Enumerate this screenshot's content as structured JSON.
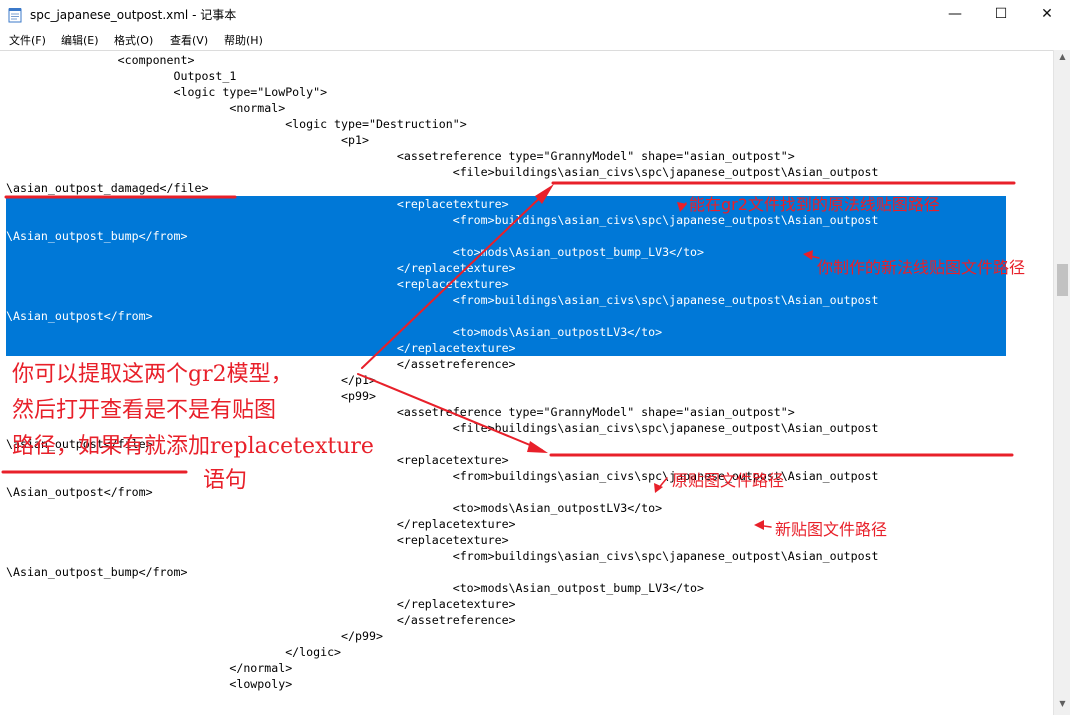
{
  "window": {
    "title": "spc_japanese_outpost.xml - 记事本",
    "minimize_glyph": "—",
    "maximize_glyph": "☐",
    "close_glyph": "✕"
  },
  "menu": {
    "items": [
      "文件(F)",
      "编辑(E)",
      "格式(O)",
      "查看(V)",
      "帮助(H)"
    ]
  },
  "editor": {
    "lines": [
      "                <component>",
      "                        Outpost_1",
      "                        <logic type=\"LowPoly\">",
      "                                <normal>",
      "                                        <logic type=\"Destruction\">",
      "                                                <p1>",
      "                                                        <assetreference type=\"GrannyModel\" shape=\"asian_outpost\">",
      "                                                                <file>buildings\\asian_civs\\spc\\japanese_outpost\\Asian_outpost",
      "\\asian_outpost_damaged</file>",
      "                                                        <replacetexture>",
      "                                                                <from>buildings\\asian_civs\\spc\\japanese_outpost\\Asian_outpost",
      "\\Asian_outpost_bump</from>",
      "                                                                <to>mods\\Asian_outpost_bump_LV3</to>",
      "                                                        </replacetexture>",
      "                                                        <replacetexture>",
      "                                                                <from>buildings\\asian_civs\\spc\\japanese_outpost\\Asian_outpost",
      "\\Asian_outpost</from>",
      "                                                                <to>mods\\Asian_outpostLV3</to>",
      "                                                        </replacetexture>",
      "                                                        </assetreference>",
      "                                                </p1>",
      "                                                <p99>",
      "                                                        <assetreference type=\"GrannyModel\" shape=\"asian_outpost\">",
      "                                                                <file>buildings\\asian_civs\\spc\\japanese_outpost\\Asian_outpost",
      "\\asian_outpost</file>",
      "                                                        <replacetexture>",
      "                                                                <from>buildings\\asian_civs\\spc\\japanese_outpost\\Asian_outpost",
      "\\Asian_outpost</from>",
      "                                                                <to>mods\\Asian_outpostLV3</to>",
      "                                                        </replacetexture>",
      "                                                        <replacetexture>",
      "                                                                <from>buildings\\asian_civs\\spc\\japanese_outpost\\Asian_outpost",
      "\\Asian_outpost_bump</from>",
      "                                                                <to>mods\\Asian_outpost_bump_LV3</to>",
      "                                                        </replacetexture>",
      "                                                        </assetreference>",
      "                                                </p99>",
      "                                        </logic>",
      "                                </normal>",
      "                                <lowpoly>"
    ]
  },
  "annotations": {
    "original_normal_path": "能在gr2文件找到的原法线贴图路径",
    "new_normal_path": "你制作的新法线贴图文件路径",
    "extract_hint": [
      "你可以提取这两个gr2模型，",
      "然后打开查看是不是有贴图",
      "路径，如果有就添加replacetexture",
      "语句"
    ],
    "original_texture_path": "原贴图文件路径",
    "new_texture_path": "新贴图文件路径"
  },
  "colors": {
    "selection": "#0078d7",
    "annotation": "#e8202a"
  }
}
